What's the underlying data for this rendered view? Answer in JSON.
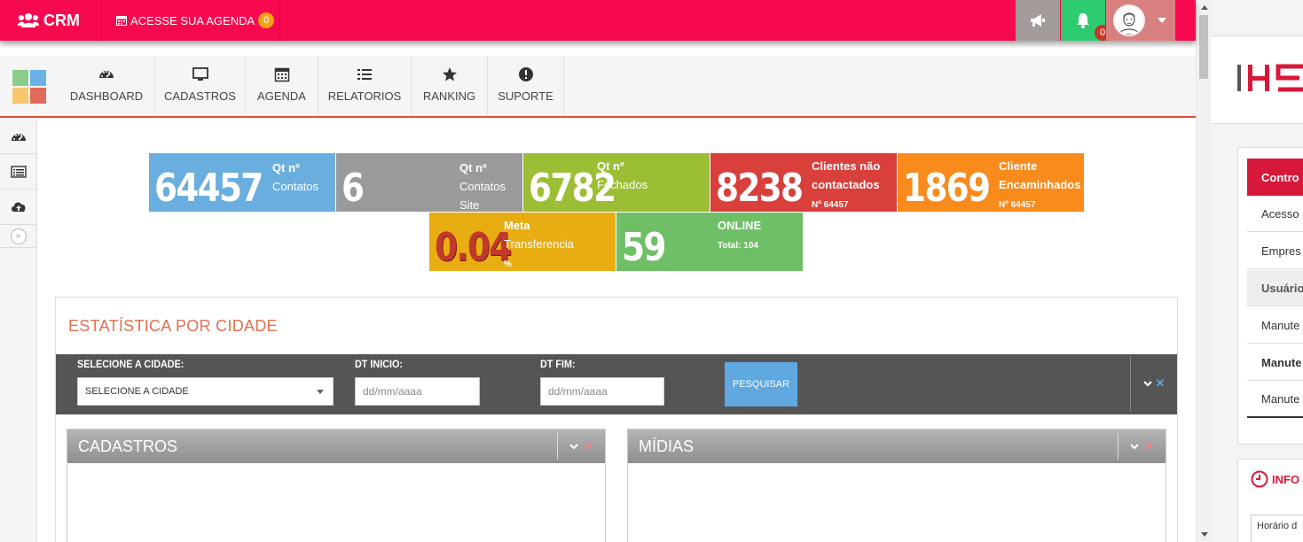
{
  "topbar": {
    "brand": "CRM",
    "agenda_label": "ACESSE SUA AGENDA",
    "agenda_count": "0",
    "notifications_count": "0"
  },
  "nav": {
    "items": [
      {
        "label": "DASHBOARD",
        "icon": "dashboard-icon"
      },
      {
        "label": "CADASTROS",
        "icon": "monitor-icon"
      },
      {
        "label": "AGENDA",
        "icon": "calendar-icon"
      },
      {
        "label": "RELATORIOS",
        "icon": "list-icon"
      },
      {
        "label": "RANKING",
        "icon": "star-icon"
      },
      {
        "label": "SUPORTE",
        "icon": "info-circle-icon"
      }
    ]
  },
  "sidebar": {
    "icons": [
      "dashboard-icon",
      "list-icon",
      "cloud-upload-icon"
    ],
    "toggle": "»"
  },
  "tiles": [
    {
      "value": "64457",
      "label1": "Qt nº",
      "label2": "Contatos",
      "label3": "",
      "color": "#6aaedf"
    },
    {
      "value": "6",
      "label1": "Qt nº",
      "label2": "Contatos",
      "label3": "Site",
      "color": "#9a9a9a"
    },
    {
      "value": "6782",
      "label1": "Qt nº",
      "label2": "Fechados",
      "label3": "",
      "color": "#9cbe35"
    },
    {
      "value": "8238",
      "label1": "Clientes não",
      "label2": "contactados",
      "label3": "Nº 64457",
      "color": "#d93f3b"
    },
    {
      "value": "1869",
      "label1": "Cliente",
      "label2": "Encaminhados",
      "label3": "Nº 64457",
      "color": "#f98a1c"
    },
    {
      "value": "0.04",
      "label1": "Meta",
      "label2": "Transferencia",
      "label3": "%",
      "color": "#e8ad12"
    },
    {
      "value": "59",
      "label1": "ONLINE",
      "label2": "Total: 104",
      "label3": "",
      "color": "#6fbf66"
    }
  ],
  "stats": {
    "title": "ESTATÍSTICA POR CIDADE",
    "city_label": "SELECIONE A CIDADE:",
    "city_value": "SELECIONE A CIDADE",
    "start_label": "DT INICIO:",
    "start_placeholder": "dd/mm/aaaa",
    "end_label": "DT FIM:",
    "end_placeholder": "dd/mm/aaaa",
    "search_button": "PESQUISAR",
    "panel_left": "CADASTROS",
    "panel_right": "MÍDIAS"
  },
  "right_pane": {
    "logo_text": "IHS",
    "header": "Contro",
    "rows": [
      "Acesso",
      "Empres",
      "Usuário",
      "Manute",
      "Manute",
      "Manute"
    ],
    "info_title": "INFO",
    "info_body": "Horário d"
  },
  "colors": {
    "topbar": "#f7094f",
    "accent_orange": "#f7a11a",
    "nav_underline": "#e04a3a",
    "stats_title": "#e07050",
    "search_button": "#5fa8e0"
  }
}
